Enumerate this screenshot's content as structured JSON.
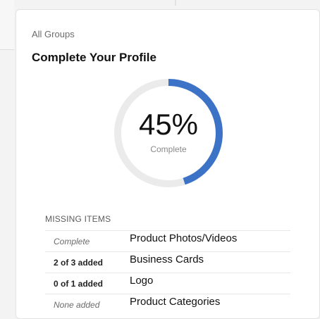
{
  "breadcrumb": {
    "label": "All Groups"
  },
  "title": "Complete Your Profile",
  "progress": {
    "percent_text": "45%",
    "percent_value": 45,
    "label": "Complete",
    "ring_color": "#3d73c6",
    "track_color": "#ebebeb"
  },
  "missing": {
    "header": "MISSING ITEMS",
    "rows": [
      {
        "status": "Complete",
        "status_style": "italic",
        "item": "Product Photos/Videos"
      },
      {
        "status": "2 of 3 added",
        "status_style": "bold",
        "item": "Business Cards"
      },
      {
        "status": "0 of 1 added",
        "status_style": "bold",
        "item": "Logo"
      },
      {
        "status": "None added",
        "status_style": "italic",
        "item": "Product Categories"
      }
    ]
  }
}
